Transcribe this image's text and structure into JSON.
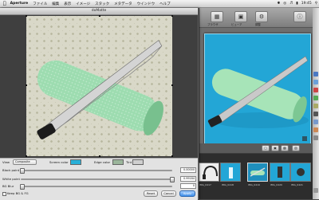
{
  "menubar": {
    "apple": "",
    "app_name": "Aperture",
    "items": [
      "ファイル",
      "編集",
      "表示",
      "イメージ",
      "スタック",
      "メタデータ",
      "ウインドウ",
      "ヘルプ"
    ],
    "clock": "19:45"
  },
  "dialog": {
    "title": "doMatte"
  },
  "controls": {
    "view_label": "View",
    "view_value": "Composite",
    "screen_color_label": "Screen color",
    "screen_color": "#29b0d8",
    "edge_color_label": "Edge color",
    "edge_color": "#9bb59b",
    "tint_label": "Tint",
    "tint_color": "#cfcfcf",
    "black_point_label": "Black point",
    "black_point_value": "0.00000",
    "white_point_label": "White point",
    "white_point_value": "0.99184",
    "bg_blur_label": "BG Blur",
    "bg_blur_value": "0",
    "keep_label": "Keep BG & FG",
    "reset_label": "Reset",
    "cancel_label": "Cancel",
    "apply_label": "Apply"
  },
  "toolbar": {
    "labels": [
      "ブラウザ",
      "ビューア",
      "調整"
    ]
  },
  "thumbnails": {
    "labels": [
      "IMG_0417",
      "IMG_0418",
      "IMG_0419",
      "IMG_0420",
      "IMG_0421"
    ]
  },
  "colors": {
    "sky_blue_background": "#23a6d6",
    "roller_green": "#9bdcae",
    "accent_apply": "#3e8ee8"
  }
}
